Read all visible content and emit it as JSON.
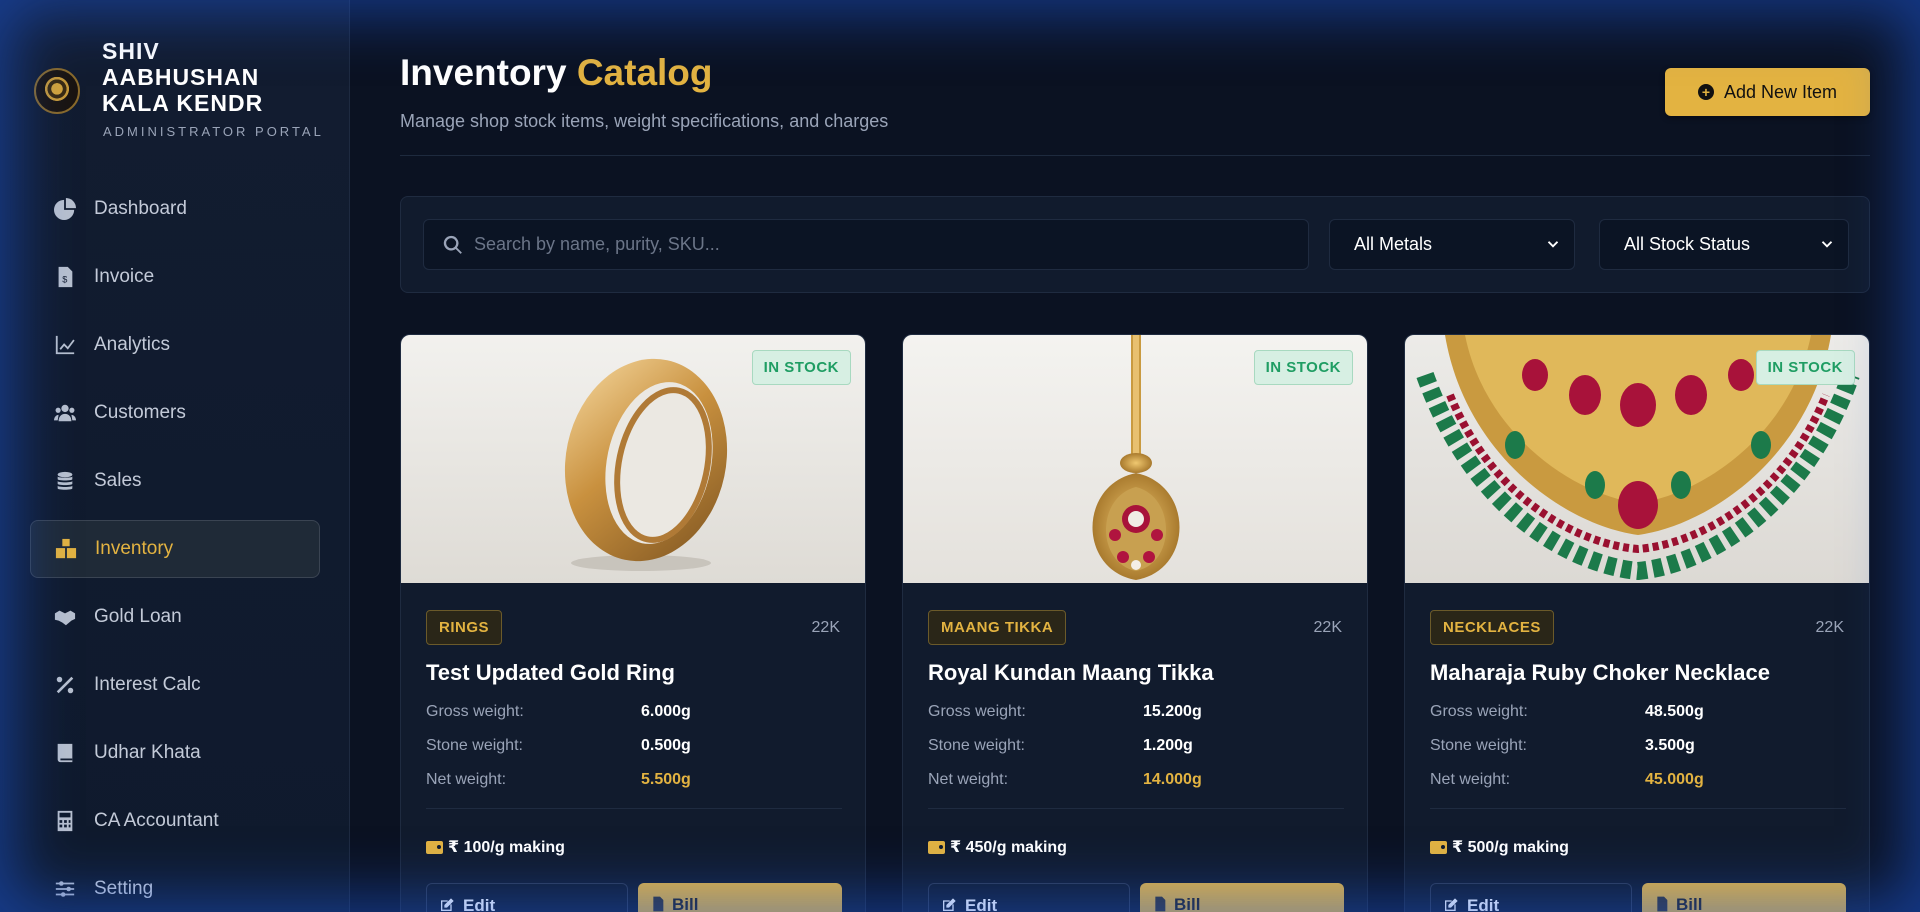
{
  "brand": {
    "name": "SHIV AABHUSHAN KALA KENDR",
    "subtitle": "ADMINISTRATOR PORTAL"
  },
  "sidebar": {
    "items": [
      {
        "label": "Dashboard",
        "icon": "pie-chart-icon"
      },
      {
        "label": "Invoice",
        "icon": "invoice-icon"
      },
      {
        "label": "Analytics",
        "icon": "line-chart-icon"
      },
      {
        "label": "Customers",
        "icon": "users-icon"
      },
      {
        "label": "Sales",
        "icon": "coins-icon"
      },
      {
        "label": "Inventory",
        "icon": "boxes-icon",
        "active": true
      },
      {
        "label": "Gold Loan",
        "icon": "handshake-icon"
      },
      {
        "label": "Interest Calc",
        "icon": "percent-icon"
      },
      {
        "label": "Udhar Khata",
        "icon": "book-icon"
      },
      {
        "label": "CA Accountant",
        "icon": "calculator-icon"
      },
      {
        "label": "Setting",
        "icon": "sliders-icon"
      }
    ]
  },
  "header": {
    "title_main": "Inventory",
    "title_accent": "Catalog",
    "subtitle": "Manage shop stock items, weight specifications, and charges",
    "add_button": "Add New Item"
  },
  "filters": {
    "search_placeholder": "Search by name, purity, SKU...",
    "metal": "All Metals",
    "stock": "All Stock Status"
  },
  "colors": {
    "accent": "#e3b341",
    "in_stock": "#1f9d63",
    "background": "#0b1222"
  },
  "labels": {
    "gross": "Gross weight:",
    "stone": "Stone weight:",
    "net": "Net weight:",
    "edit": "Edit",
    "bill": "Bill"
  },
  "products": [
    {
      "status": "IN STOCK",
      "category": "RINGS",
      "purity": "22K",
      "name": "Test Updated Gold Ring",
      "gross": "6.000g",
      "stone": "0.500g",
      "net": "5.500g",
      "making": "₹ 100/g making"
    },
    {
      "status": "IN STOCK",
      "category": "MAANG TIKKA",
      "purity": "22K",
      "name": "Royal Kundan Maang Tikka",
      "gross": "15.200g",
      "stone": "1.200g",
      "net": "14.000g",
      "making": "₹ 450/g making"
    },
    {
      "status": "IN STOCK",
      "category": "NECKLACES",
      "purity": "22K",
      "name": "Maharaja Ruby Choker Necklace",
      "gross": "48.500g",
      "stone": "3.500g",
      "net": "45.000g",
      "making": "₹ 500/g making"
    }
  ]
}
